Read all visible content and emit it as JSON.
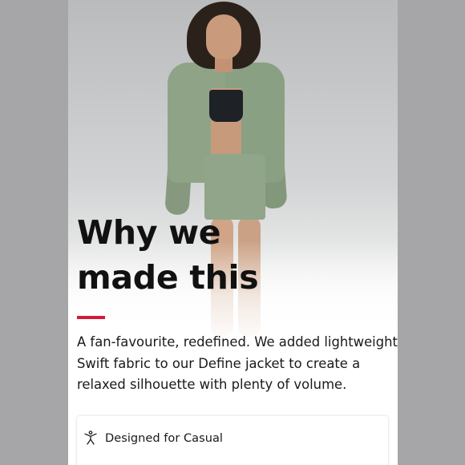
{
  "colors": {
    "accent": "#d31a38",
    "jacket": "#8fa487",
    "side_strip": "#a6a6a8",
    "text": "#111111"
  },
  "hero": {
    "image": "model-wearing-green-jacket-and-shorts"
  },
  "headline": {
    "line1": "Why we",
    "line2": "made this"
  },
  "description": {
    "line1": "A fan-favourite, redefined. We added lightweight",
    "line2": "Swift fabric to our Define jacket to create a",
    "line3": "relaxed silhouette with plenty of volume."
  },
  "feature": {
    "icon": "person-stretch-icon",
    "label": "Designed for Casual"
  }
}
